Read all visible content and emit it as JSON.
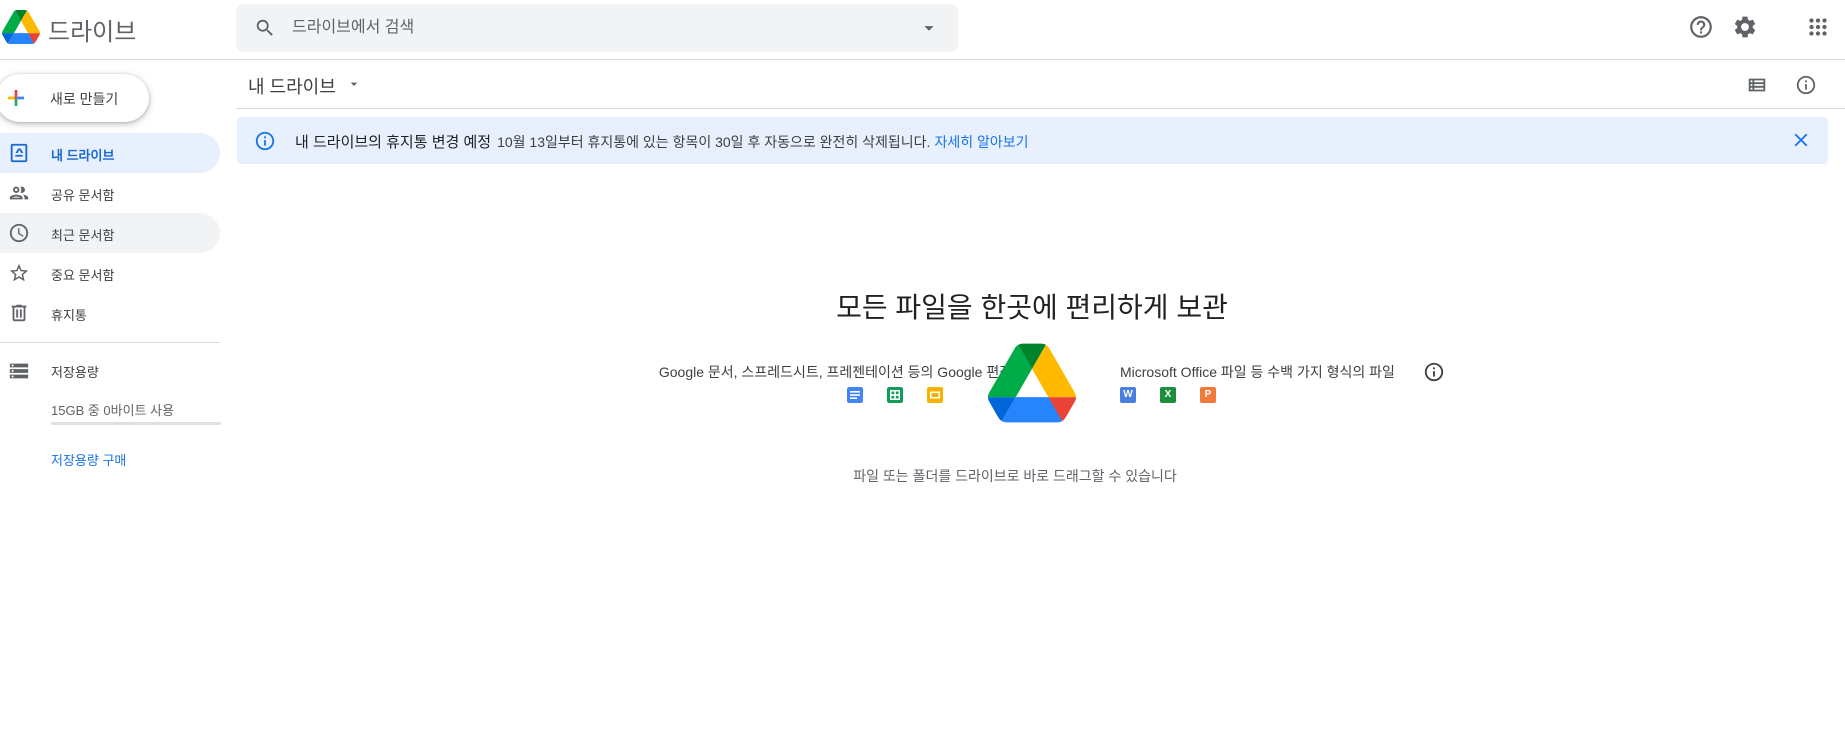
{
  "header": {
    "app_title": "드라이브",
    "search_placeholder": "드라이브에서 검색",
    "icons": [
      "help-icon",
      "settings-icon",
      "apps-grid-icon"
    ]
  },
  "sidebar": {
    "new_button": "새로 만들기",
    "items": [
      {
        "label": "내 드라이브",
        "icon": "my-drive-icon",
        "active": true
      },
      {
        "label": "공유 문서함",
        "icon": "shared-people-icon"
      },
      {
        "label": "최근 문서함",
        "icon": "clock-icon"
      },
      {
        "label": "중요 문서함",
        "icon": "star-icon"
      },
      {
        "label": "휴지통",
        "icon": "trash-icon"
      }
    ],
    "storage": {
      "label": "저장용량",
      "usage": "15GB 중 0바이트 사용",
      "used_fraction": 0,
      "buy_link": "저장용량 구매"
    }
  },
  "main": {
    "breadcrumb": "내 드라이브",
    "banner": {
      "title": "내 드라이브의 휴지통 변경 예정",
      "message": "10월 13일부터 휴지통에 있는 항목이 30일 후 자동으로 완전히 삭제됩니다.",
      "link": "자세히 알아보기"
    },
    "empty_state": {
      "title": "모든 파일을 한곳에 편리하게 보관",
      "google_text": "Google 문서, 스프레드시트, 프레젠테이션 등의 Google 편집기",
      "microsoft_text": "Microsoft Office 파일 등 수백 가지 형식의 파일",
      "ms_letters": [
        "W",
        "X",
        "P"
      ],
      "drag_hint": "파일 또는 폴더를 드라이브로 바로 드래그할 수 있습니다"
    }
  },
  "colors": {
    "accent": "#1a73e8",
    "active_bg": "#e8f0fe",
    "docs_blue": "#4285f4",
    "sheets_green": "#0f9d58",
    "slides_yellow": "#f4b400",
    "word_blue": "#4a7fe0",
    "excel_green": "#1e8e3e",
    "powerpoint_orange": "#f07a3a"
  }
}
